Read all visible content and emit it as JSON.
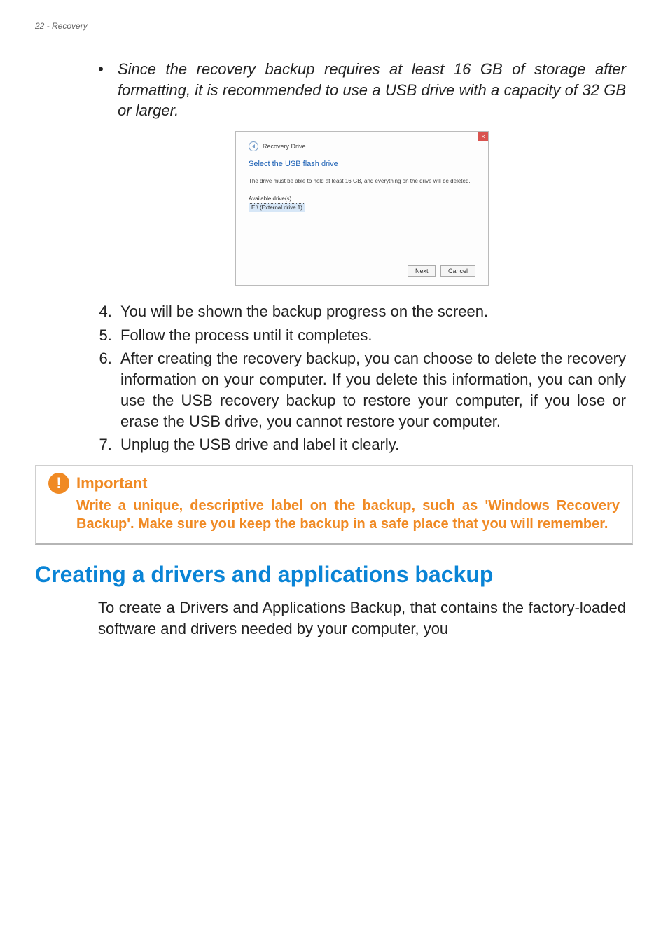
{
  "header": {
    "left": "22 - Recovery"
  },
  "bullet": {
    "text": "Since the recovery backup requires at least 16 GB of storage after formatting, it is recommended to use a USB drive with a capacity of 32 GB or larger."
  },
  "dialog": {
    "close": "×",
    "crumb": "Recovery Drive",
    "title": "Select the USB flash drive",
    "note": "The drive must be able to hold at least 16 GB, and everything on the drive will be deleted.",
    "avail_label": "Available drive(s)",
    "selected": "E:\\ (External drive 1)",
    "next": "Next",
    "cancel": "Cancel"
  },
  "steps": {
    "s4": "You will be shown the backup progress on the screen.",
    "s5": "Follow the process until it completes.",
    "s6": "After creating the recovery backup, you can choose to delete the recovery information on your computer. If you delete this information, you can only use the USB recovery backup to restore your computer, if you lose or erase the USB drive, you cannot restore your computer.",
    "s7": "Unplug the USB drive and label it clearly."
  },
  "callout": {
    "title": "Important",
    "body": "Write a unique, descriptive label on the backup, such as 'Windows Recovery Backup'. Make sure you keep the backup in a safe place that you will remember."
  },
  "section": {
    "heading": "Creating a drivers and applications backup",
    "para": "To create a Drivers and Applications Backup, that contains the factory-loaded software and drivers needed by your computer, you"
  }
}
